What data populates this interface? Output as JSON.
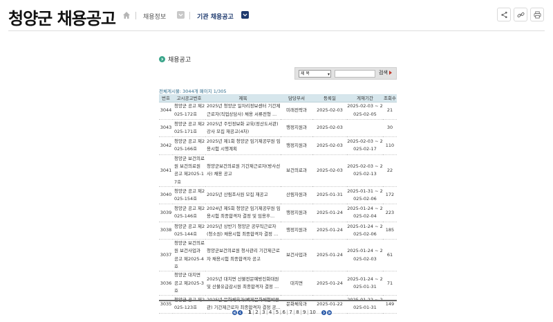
{
  "page": {
    "title": "청양군 채용공고"
  },
  "breadcrumb": {
    "level1": "채용정보",
    "level2": "기관 채용공고"
  },
  "section": {
    "title": "채용공고"
  },
  "search": {
    "select_value": "제 목",
    "button_label": "검색"
  },
  "summary": "전체게시물: 3044개 페이지 1/305",
  "table": {
    "headers": [
      "번호",
      "고시공고번호",
      "제목",
      "담당부서",
      "등록일",
      "게재기간",
      "조회수"
    ],
    "rows": [
      {
        "no": "3044",
        "notice_no": "청양군 공고 제2025-172호",
        "title": "2025년 청양군 일자리정보센터 기간제근로자(직업상담사) 채용 서류전형 ...",
        "dept": "미래전략과",
        "date": "2025-02-03",
        "period": "2025-02-03 ~ 2025-02-05",
        "views": "21"
      },
      {
        "no": "3043",
        "notice_no": "청양군 공고 제2025-171호",
        "title": "2025년 주민정보화 교육(정산도서관) 강사 모집 재공고(4차)",
        "dept": "행정지원과",
        "date": "2025-02-03",
        "period": "",
        "views": "30"
      },
      {
        "no": "3042",
        "notice_no": "청양군 공고 제2025-166호",
        "title": "2025년 제1회 청양군 임기제공무원 임용시험 시행계획",
        "dept": "행정지원과",
        "date": "2025-02-03",
        "period": "2025-02-03 ~ 2025-02-17",
        "views": "110"
      },
      {
        "no": "3041",
        "notice_no": "청양군 보건의료원 보건의료원 공고 제2025-17호",
        "title": "청양군보건의료원 기간제근로자(방사선사) 채용 공고",
        "dept": "보건의료과",
        "date": "2025-02-03",
        "period": "2025-02-03 ~ 2025-02-13",
        "views": "22"
      },
      {
        "no": "3040",
        "notice_no": "청양군 공고 제2025-154호",
        "title": "2025년 산림조사원 모집 재공고",
        "dept": "산림자원과",
        "date": "2025-01-31",
        "period": "2025-01-31 ~ 2025-02-06",
        "views": "172"
      },
      {
        "no": "3039",
        "notice_no": "청양군 공고 제2025-146호",
        "title": "2024년 제5회 청양군 임기제공무원 임용시험 최종합격자 결정 및 임용후...",
        "dept": "행정지원과",
        "date": "2025-01-24",
        "period": "2025-01-24 ~ 2025-02-04",
        "views": "223"
      },
      {
        "no": "3038",
        "notice_no": "청양군 공고 제2025-144호",
        "title": "2025년 상반기 청양군 공무직근로자(청소원) 채용시험 최종합격자 결정 ...",
        "dept": "행정지원과",
        "date": "2025-01-24",
        "period": "2025-01-24 ~ 2025-02-06",
        "views": "185"
      },
      {
        "no": "3037",
        "notice_no": "청양군 보건의료원 보건사업과 공고 제2025-4호",
        "title": "청양군보건의료원 청사관리 기간제근로자 채용시험 최종합격자 공고",
        "dept": "보건사업과",
        "date": "2025-01-24",
        "period": "2025-01-24 ~ 2025-02-03",
        "views": "61"
      },
      {
        "no": "3036",
        "notice_no": "청양군 대치면 공고 제2025-3호",
        "title": "2025년 대치면 산불전문예방진화대원 및 산불유급감시원 최종합격자 결정 ...",
        "dept": "대치면",
        "date": "2025-01-24",
        "period": "2025-01-24 ~ 2025-01-31",
        "views": "71"
      },
      {
        "no": "3035",
        "notice_no": "청양군 공고 제2025-123호",
        "title": "2025년 문화체육과(백제문화체험박물관) 기간제근로자 최종합격자 결정 공...",
        "dept": "문화체육과",
        "date": "2025-01-22",
        "period": "2025-01-22 ~ 2025-01-31",
        "views": "149"
      }
    ]
  },
  "pagination": {
    "current": "1",
    "pages": [
      "1",
      "2",
      "3",
      "4",
      "5",
      "6",
      "7",
      "8",
      "9",
      "10"
    ]
  },
  "icons": [
    "home-icon",
    "chevron-down-icon",
    "share-icon",
    "link-icon",
    "print-icon",
    "first-page-icon",
    "prev-page-icon",
    "next-page-icon",
    "last-page-icon"
  ],
  "colors": {
    "accent_green": "#3aa58a",
    "header_bg": "#d6e6ec",
    "pager_blue": "#2a5aa8",
    "breadcrumb_dark": "#1e3a6e"
  }
}
